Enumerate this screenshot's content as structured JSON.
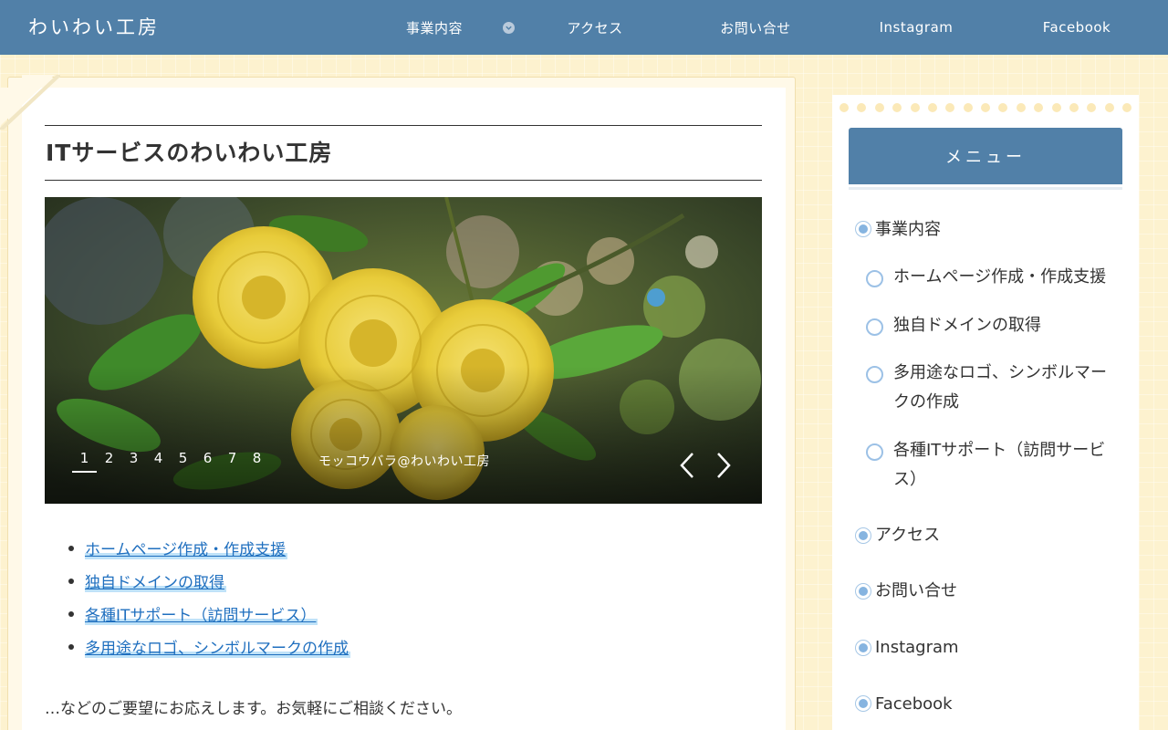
{
  "header": {
    "site_title": "わいわい工房",
    "nav": [
      "事業内容",
      "アクセス",
      "お問い合せ",
      "Instagram",
      "Facebook"
    ]
  },
  "main": {
    "page_title": "ITサービスのわいわい工房",
    "slider": {
      "pages": [
        "1",
        "2",
        "3",
        "4",
        "5",
        "6",
        "7",
        "8"
      ],
      "active_page": "1",
      "caption": "モッコウバラ@わいわい工房"
    },
    "links": [
      "ホームページ作成・作成支援",
      "独自ドメインの取得",
      "各種ITサポート（訪問サービス）",
      "多用途なロゴ、シンボルマークの作成"
    ],
    "intro": "…などのご要望にお応えします。お気軽にご相談ください。"
  },
  "sidebar": {
    "menu_title": "メニュー",
    "items": [
      {
        "label": "事業内容"
      },
      {
        "label": "ホームページ作成・作成支援"
      },
      {
        "label": "独自ドメインの取得"
      },
      {
        "label_line1": "多用途なロゴ、シンボルマー",
        "label_line2": "クの作成"
      },
      {
        "label_line1": "各種ITサポート（訪問サービ",
        "label_line2": "ス）"
      },
      {
        "label": "アクセス"
      },
      {
        "label": "お問い合せ"
      },
      {
        "label": "Instagram"
      },
      {
        "label": "Facebook"
      }
    ]
  },
  "colors": {
    "header_bg": "#5180a8",
    "page_bg": "#fdf2cf",
    "link": "#1f6fbf",
    "link_highlight": "#bfe2f8",
    "radio": "#86b4e0"
  },
  "icons": {
    "dropdown": "chevron-down-icon",
    "prev": "chevron-left-icon",
    "next": "chevron-right-icon"
  }
}
